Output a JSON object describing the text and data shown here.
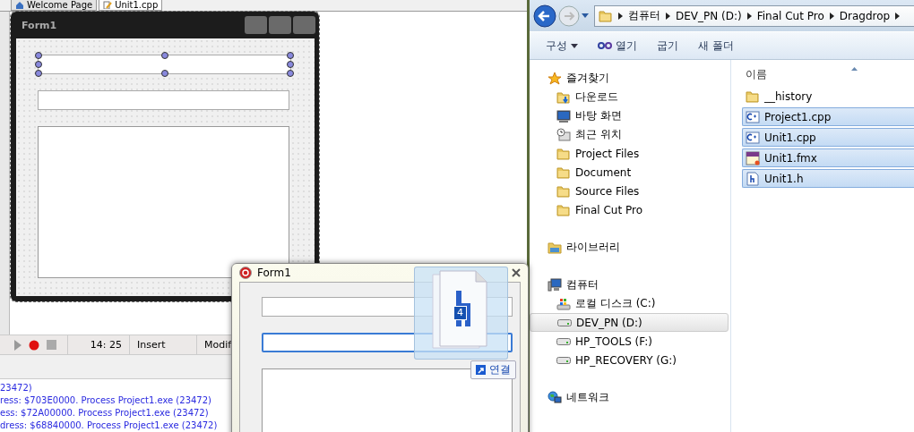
{
  "ide": {
    "tabs": [
      {
        "label": "Welcome Page",
        "selected": false
      },
      {
        "label": "Unit1.cpp",
        "selected": true
      }
    ],
    "designer_form": {
      "title": "Form1",
      "controls": [
        {
          "kind": "edit",
          "selected": true
        },
        {
          "kind": "edit",
          "selected": false
        },
        {
          "kind": "memo",
          "selected": false
        }
      ]
    },
    "status_bar": {
      "position": "14: 25",
      "mode": "Insert",
      "state": "Modif"
    },
    "messages": [
      "23472)",
      "ress: $703E0000. Process Project1.exe (23472)",
      "ess: $72A00000. Process Project1.exe (23472)",
      "dress: $68840000. Process Project1.exe (23472)"
    ]
  },
  "running_form": {
    "title": "Form1",
    "controls": [
      {
        "kind": "edit",
        "focused": false
      },
      {
        "kind": "edit",
        "focused": true
      },
      {
        "kind": "memo"
      }
    ]
  },
  "drag": {
    "count": "4",
    "tooltip": "연결"
  },
  "explorer": {
    "breadcrumb": [
      "컴퓨터",
      "DEV_PN (D:)",
      "Final Cut Pro",
      "Dragdrop"
    ],
    "toolbar": [
      {
        "label": "구성",
        "kind": "menu"
      },
      {
        "label": "열기",
        "kind": "open"
      },
      {
        "label": "굽기",
        "kind": "plain"
      },
      {
        "label": "새 폴더",
        "kind": "plain"
      }
    ],
    "nav": [
      {
        "label": "즐겨찾기",
        "kind": "star",
        "selected": false,
        "children": [
          {
            "label": "다운로드",
            "kind": "download",
            "selected": false
          },
          {
            "label": "바탕 화면",
            "kind": "desktop",
            "selected": false
          },
          {
            "label": "최근 위치",
            "kind": "recent",
            "selected": false
          },
          {
            "label": "Project Files",
            "kind": "folder",
            "selected": false
          },
          {
            "label": "Document",
            "kind": "folder",
            "selected": false
          },
          {
            "label": "Source Files",
            "kind": "folder",
            "selected": false
          },
          {
            "label": "Final Cut Pro",
            "kind": "folder",
            "selected": false
          }
        ]
      },
      {
        "label": "라이브러리",
        "kind": "library",
        "selected": false
      },
      {
        "label": "컴퓨터",
        "kind": "computer",
        "selected": false,
        "children": [
          {
            "label": "로컬 디스크 (C:)",
            "kind": "windisk",
            "selected": false
          },
          {
            "label": "DEV_PN (D:)",
            "kind": "drive",
            "selected": true
          },
          {
            "label": "HP_TOOLS (F:)",
            "kind": "drive",
            "selected": false
          },
          {
            "label": "HP_RECOVERY (G:)",
            "kind": "drive",
            "selected": false
          }
        ]
      },
      {
        "label": "네트워크",
        "kind": "network",
        "selected": false
      }
    ],
    "column": "이름",
    "files": [
      {
        "name": "__history",
        "kind": "folder",
        "selected": false
      },
      {
        "name": "Project1.cpp",
        "kind": "cpp",
        "selected": true
      },
      {
        "name": "Unit1.cpp",
        "kind": "cpp",
        "selected": true
      },
      {
        "name": "Unit1.fmx",
        "kind": "fmx",
        "selected": true
      },
      {
        "name": "Unit1.h",
        "kind": "h",
        "selected": true
      }
    ]
  }
}
